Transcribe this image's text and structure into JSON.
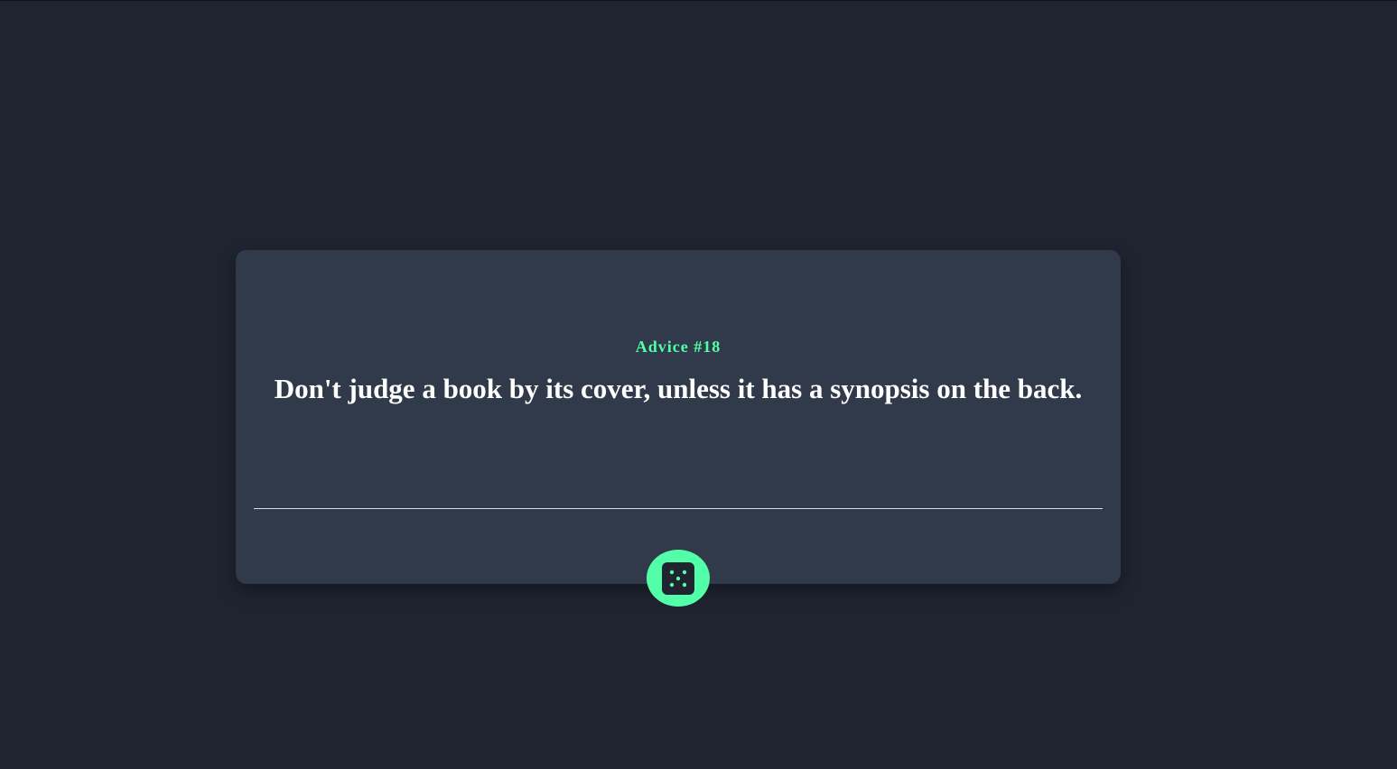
{
  "advice": {
    "number_label": "Advice #18",
    "text": "Don't judge a book by its cover, unless it has a synopsis on the back."
  },
  "button": {
    "icon": "dice-icon",
    "aria_label": "Get new advice"
  },
  "colors": {
    "background": "#1f2430",
    "card": "#313a4a",
    "accent": "#52ffa8",
    "text": "#ffffff",
    "divider": "#d8dde6",
    "dice_body": "#1f2430"
  }
}
